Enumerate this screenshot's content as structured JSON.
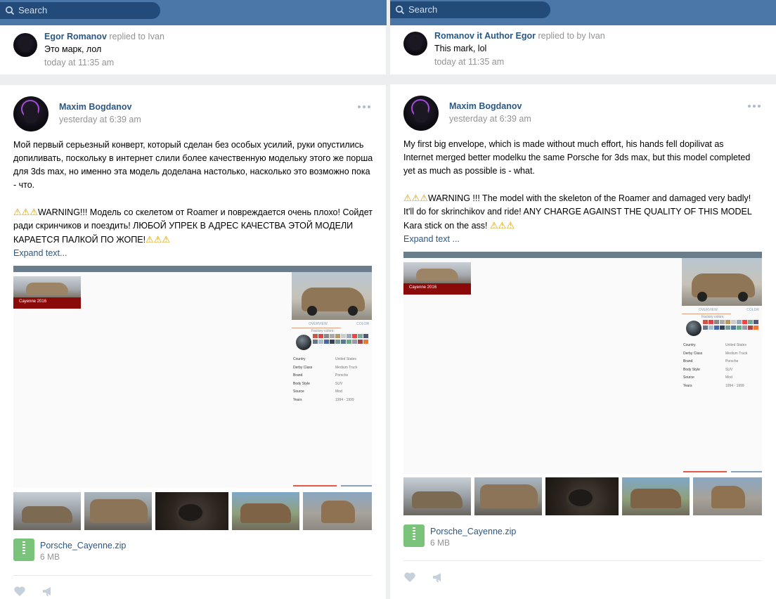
{
  "search": {
    "placeholder": "Search"
  },
  "left": {
    "reply": {
      "author": "Egor Romanov",
      "replied": "replied to Ivan",
      "text": "Это марк, лол",
      "time": "today at 11:35 am"
    },
    "post": {
      "author": "Maxim Bogdanov",
      "time": "yesterday at 6:39 am",
      "paragraph1": "Мой первый серьезный конверт, который сделан без особых усилий, руки опустились допиливать, поскольку в интернет слили более качественную модельку этого же порша для 3ds max, но именно эта модель доделана настолько, насколько это возможно пока - что.",
      "paragraph2": "WARNING!!! Модель со скелетом от Roamer и повреждается очень плохо! Сойдет ради скринчиков и поездить! ЛЮБОЙ УПРЕК В АДРЕС КАЧЕСТВА ЭТОЙ МОДЕЛИ КАРАЕТСЯ ПАЛКОЙ ПО ЖОПЕ!",
      "expand": "Expand text...",
      "file_name": "Porsche_Cayenne.zip",
      "file_size": "6 MB"
    }
  },
  "right": {
    "reply": {
      "author": "Romanov it Author Egor",
      "replied": "replied to by Ivan",
      "text": "This mark, lol",
      "time": "today at 11:35 am"
    },
    "post": {
      "author": "Maxim Bogdanov",
      "time": "yesterday at 6:39 am",
      "paragraph1": "My first big envelope, which is made without much effort, his hands fell dopilivat as Internet merged better modelku the same Porsche for 3ds max, but this model completed yet as much as possible is - what.",
      "paragraph2": "WARNING !!! The model with the skeleton of the Roamer and damaged very badly! It'll do for skrinchikov and ride! ANY CHARGE AGAINST THE QUALITY OF THIS MODEL Kara stick on the ass!",
      "expand": "Expand text ...",
      "file_name": "Porsche_Cayenne.zip",
      "file_size": "6 MB"
    }
  },
  "game_screenshot": {
    "card_label": "Cayenne 2016",
    "tab_overview": "OVERVIEW",
    "tab_color": "COLOR",
    "factory_colors": "Factory colors:",
    "specs": [
      {
        "key": "Country",
        "value": "United States"
      },
      {
        "key": "Derby Class",
        "value": "Medium Truck"
      },
      {
        "key": "Brand",
        "value": "Porsche"
      },
      {
        "key": "Body Style",
        "value": "SUV"
      },
      {
        "key": "Source",
        "value": "Mod"
      },
      {
        "key": "Years",
        "value": "1994 - 1999"
      }
    ]
  },
  "warning_glyph": "⚠",
  "colors": {
    "topbar": "#4a76a8",
    "link": "#2a5885",
    "muted": "#939393",
    "file_icon": "#7ac37b"
  }
}
